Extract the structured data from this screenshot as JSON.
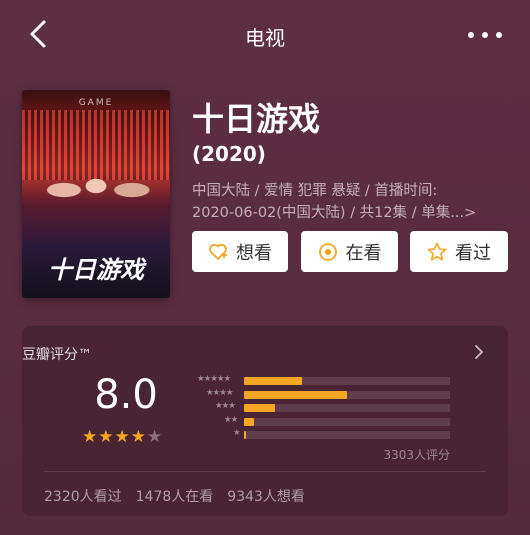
{
  "nav": {
    "title": "电视",
    "back_icon": "chevron-left-icon",
    "more_icon": "more-dots-icon"
  },
  "movie": {
    "title": "十日游戏",
    "year": "(2020)",
    "meta_line1": "中国大陆 / 爱情 犯罪 悬疑 / 首播时间:",
    "meta_line2": "2020-06-02(中国大陆) / 共12集 / 单集...>",
    "poster_caption": "GAME",
    "poster_logo": "十日游戏"
  },
  "actions": {
    "want_label": "想看",
    "watching_label": "在看",
    "watched_label": "看过"
  },
  "rating": {
    "title": "豆瓣评分™",
    "score": "8.0",
    "stars_filled": 4,
    "stars_total": 5,
    "count_text": "3303人评分",
    "distribution": [
      {
        "label": "★★★★★",
        "value": 0.28
      },
      {
        "label": "★★★★",
        "value": 0.5
      },
      {
        "label": "★★★",
        "value": 0.15
      },
      {
        "label": "★★",
        "value": 0.05
      },
      {
        "label": "★",
        "value": 0.01
      }
    ]
  },
  "stats": {
    "watched": "2320人看过",
    "watching": "1478人在看",
    "want": "9343人想看"
  },
  "colors": {
    "accent": "#f5a623",
    "background": "#5a2c40",
    "card": "#482434"
  }
}
